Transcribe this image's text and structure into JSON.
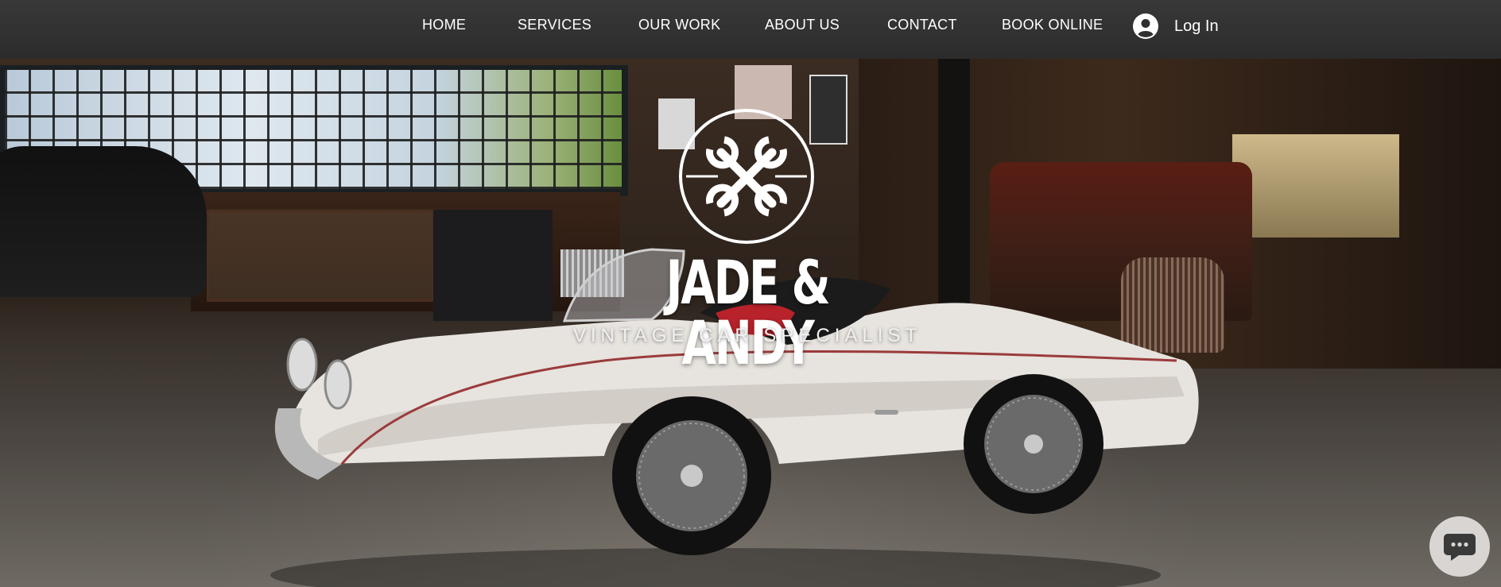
{
  "nav": {
    "items": [
      {
        "label": "HOME"
      },
      {
        "label": "SERVICES"
      },
      {
        "label": "OUR WORK"
      },
      {
        "label": "ABOUT US"
      },
      {
        "label": "CONTACT"
      },
      {
        "label": "BOOK ONLINE"
      }
    ],
    "login_label": "Log In",
    "login_icon": "user-avatar-icon"
  },
  "hero": {
    "brand_title": "JADE & ANDY",
    "brand_subtitle": "VINTAGE CAR SPECIALIST",
    "logo_icon": "crossed-wrenches-icon"
  },
  "chat": {
    "icon": "chat-bubble-icon"
  },
  "colors": {
    "topbar": "#2f2f2f",
    "nav_text": "#ffffff",
    "chat_button": "#d9d5d2",
    "chat_icon": "#3a3a3a"
  }
}
